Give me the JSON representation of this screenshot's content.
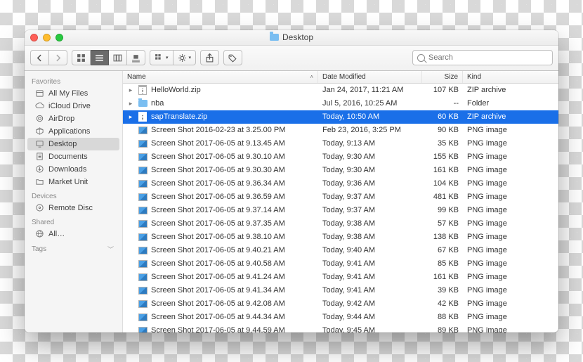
{
  "window": {
    "title": "Desktop"
  },
  "toolbar": {
    "search_placeholder": "Search"
  },
  "sidebar": {
    "sections": [
      {
        "title": "Favorites",
        "items": [
          {
            "label": "All My Files",
            "icon": "all-files"
          },
          {
            "label": "iCloud Drive",
            "icon": "icloud"
          },
          {
            "label": "AirDrop",
            "icon": "airdrop"
          },
          {
            "label": "Applications",
            "icon": "apps"
          },
          {
            "label": "Desktop",
            "icon": "desktop",
            "selected": true
          },
          {
            "label": "Documents",
            "icon": "docs"
          },
          {
            "label": "Downloads",
            "icon": "downloads"
          },
          {
            "label": "Market Unit",
            "icon": "folder"
          }
        ]
      },
      {
        "title": "Devices",
        "items": [
          {
            "label": "Remote Disc",
            "icon": "disc"
          }
        ]
      },
      {
        "title": "Shared",
        "items": [
          {
            "label": "All…",
            "icon": "network"
          }
        ]
      },
      {
        "title": "Tags",
        "collapsed": true,
        "items": []
      }
    ]
  },
  "columns": {
    "name": "Name",
    "date": "Date Modified",
    "size": "Size",
    "kind": "Kind"
  },
  "files": [
    {
      "name": "HelloWorld.zip",
      "date": "Jan 24, 2017, 11:21 AM",
      "size": "107 KB",
      "kind": "ZIP archive",
      "type": "zip",
      "expandable": true
    },
    {
      "name": "nba",
      "date": "Jul 5, 2016, 10:25 AM",
      "size": "--",
      "kind": "Folder",
      "type": "folder",
      "expandable": true
    },
    {
      "name": "sapTranslate.zip",
      "date": "Today, 10:50 AM",
      "size": "60 KB",
      "kind": "ZIP archive",
      "type": "zip",
      "expandable": true,
      "selected": true
    },
    {
      "name": "Screen Shot 2016-02-23 at 3.25.00 PM",
      "date": "Feb 23, 2016, 3:25 PM",
      "size": "90 KB",
      "kind": "PNG image",
      "type": "png"
    },
    {
      "name": "Screen Shot 2017-06-05 at 9.13.45 AM",
      "date": "Today, 9:13 AM",
      "size": "35 KB",
      "kind": "PNG image",
      "type": "png"
    },
    {
      "name": "Screen Shot 2017-06-05 at 9.30.10 AM",
      "date": "Today, 9:30 AM",
      "size": "155 KB",
      "kind": "PNG image",
      "type": "png"
    },
    {
      "name": "Screen Shot 2017-06-05 at 9.30.30 AM",
      "date": "Today, 9:30 AM",
      "size": "161 KB",
      "kind": "PNG image",
      "type": "png"
    },
    {
      "name": "Screen Shot 2017-06-05 at 9.36.34 AM",
      "date": "Today, 9:36 AM",
      "size": "104 KB",
      "kind": "PNG image",
      "type": "png"
    },
    {
      "name": "Screen Shot 2017-06-05 at 9.36.59 AM",
      "date": "Today, 9:37 AM",
      "size": "481 KB",
      "kind": "PNG image",
      "type": "png"
    },
    {
      "name": "Screen Shot 2017-06-05 at 9.37.14 AM",
      "date": "Today, 9:37 AM",
      "size": "99 KB",
      "kind": "PNG image",
      "type": "png"
    },
    {
      "name": "Screen Shot 2017-06-05 at 9.37.35 AM",
      "date": "Today, 9:38 AM",
      "size": "57 KB",
      "kind": "PNG image",
      "type": "png"
    },
    {
      "name": "Screen Shot 2017-06-05 at 9.38.10 AM",
      "date": "Today, 9:38 AM",
      "size": "138 KB",
      "kind": "PNG image",
      "type": "png"
    },
    {
      "name": "Screen Shot 2017-06-05 at 9.40.21 AM",
      "date": "Today, 9:40 AM",
      "size": "67 KB",
      "kind": "PNG image",
      "type": "png"
    },
    {
      "name": "Screen Shot 2017-06-05 at 9.40.58 AM",
      "date": "Today, 9:41 AM",
      "size": "85 KB",
      "kind": "PNG image",
      "type": "png"
    },
    {
      "name": "Screen Shot 2017-06-05 at 9.41.24 AM",
      "date": "Today, 9:41 AM",
      "size": "161 KB",
      "kind": "PNG image",
      "type": "png"
    },
    {
      "name": "Screen Shot 2017-06-05 at 9.41.34 AM",
      "date": "Today, 9:41 AM",
      "size": "39 KB",
      "kind": "PNG image",
      "type": "png"
    },
    {
      "name": "Screen Shot 2017-06-05 at 9.42.08 AM",
      "date": "Today, 9:42 AM",
      "size": "42 KB",
      "kind": "PNG image",
      "type": "png"
    },
    {
      "name": "Screen Shot 2017-06-05 at 9.44.34 AM",
      "date": "Today, 9:44 AM",
      "size": "88 KB",
      "kind": "PNG image",
      "type": "png"
    },
    {
      "name": "Screen Shot 2017-06-05 at 9.44.59 AM",
      "date": "Today, 9:45 AM",
      "size": "89 KB",
      "kind": "PNG image",
      "type": "png"
    }
  ]
}
